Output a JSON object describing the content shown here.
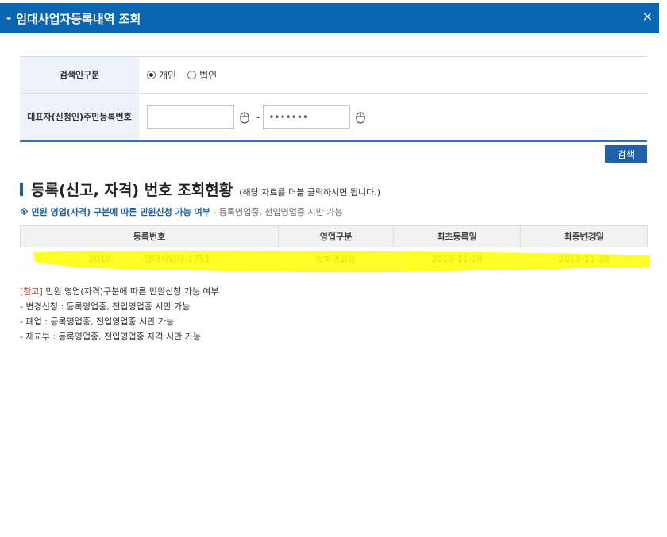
{
  "window": {
    "title": "임대사업자등록내역 조회",
    "title_prefix": "-",
    "close_symbol": "×"
  },
  "search_form": {
    "type_label": "검색인구분",
    "type_options": [
      {
        "label": "개인",
        "selected": true
      },
      {
        "label": "법인",
        "selected": false
      }
    ],
    "rep_label_line1": "대표자(신청인)",
    "rep_label_line2": "주민등록번호",
    "ssn_first_value": "",
    "ssn_separator": "-",
    "ssn_second_value": "•••••••",
    "search_button": "검색"
  },
  "section": {
    "title": "등록(신고, 자격) 번호 조회현황",
    "subtitle": "(해당 자료를 더블 클릭하시면 됩니다.)",
    "notice_strong": "※ 민원 영업(자격) 구분에 따른 민원신청 가능 여부",
    "notice_rest": " - 등록영업중, 전입영업중 시만 가능"
  },
  "results": {
    "columns": [
      "등록번호",
      "영업구분",
      "최초등록일",
      "최종변경일"
    ],
    "rows": [
      {
        "reg_no_prefix": "2019-",
        "reg_no_suffix": "-임대사업자-1751",
        "status": "등록영업중",
        "first_date": "2019-11-28",
        "last_date": "2019-11-28"
      }
    ],
    "highlight_color": "#ffff00"
  },
  "notes": {
    "ref_tag": "[참고]",
    "ref_text": " 민원 영업(자격)구분에 따른 민원신청 가능 여부",
    "line1": "- 변경신청 : 등록영업중, 전입영업중 시만 가능",
    "line2": "- 폐업 : 등록영업중, 전입영업중 시만 가능",
    "line3": "- 재교부 : 등록영업중, 전입영업중 자격 시만 가능"
  }
}
